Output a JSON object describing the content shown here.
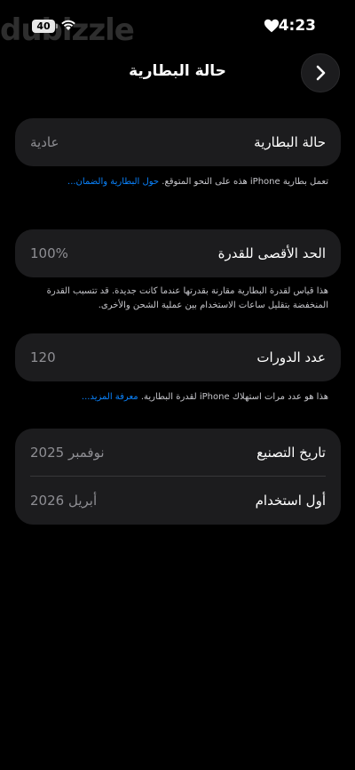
{
  "status_bar": {
    "battery_level": "40",
    "watermark": "dubizzle",
    "time": "4:23"
  },
  "header": {
    "title": "حالة البطارية",
    "back_icon": "chevron-right-icon"
  },
  "battery_condition": {
    "label": "حالة البطارية",
    "value": "عادية",
    "footnote_text": "تعمل بطارية iPhone هذه على النحو المتوقع. ",
    "footnote_link": "حول البطارية والضمان..."
  },
  "maximum_capacity": {
    "label": "الحد الأقصى للقدرة",
    "value": "100%",
    "footnote_text": "هذا قياس لقدرة البطارية مقارنة بقدرتها عندما كانت جديدة. قد تتسبب القدرة المنخفضة بتقليل ساعات الاستخدام بين عملية الشحن والأخرى."
  },
  "cycle_count": {
    "label": "عدد الدورات",
    "value": "120",
    "footnote_text": "هذا هو عدد مرات استهلاك iPhone لقدرة البطارية. ",
    "footnote_link": "معرفة المزيد..."
  },
  "dates": {
    "manufacture_label": "تاريخ التصنيع",
    "manufacture_value": "نوفمبر 2025",
    "first_use_label": "أول استخدام",
    "first_use_value": "أبريل 2026"
  },
  "colors": {
    "background": "#000000",
    "card": "#1c1c1e",
    "link": "#0a84ff",
    "secondary_text": "#8e8e93"
  }
}
